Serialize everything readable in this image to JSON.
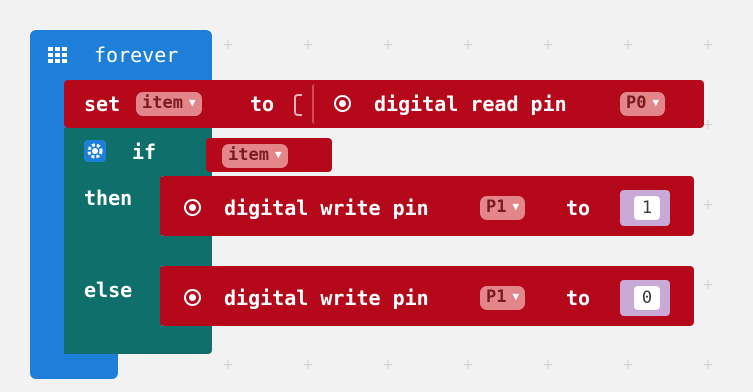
{
  "forever": {
    "label": "forever"
  },
  "set_block": {
    "set_label": "set",
    "variable": "item",
    "to_label": "to",
    "read_label": "digital read pin",
    "read_pin": "P0"
  },
  "if_block": {
    "if_label": "if",
    "condition_var": "item",
    "then_label": "then",
    "else_label": "else"
  },
  "write_then": {
    "label": "digital write pin",
    "pin": "P1",
    "to_label": "to",
    "value": "1"
  },
  "write_else": {
    "label": "digital write pin",
    "pin": "P1",
    "to_label": "to",
    "value": "0"
  },
  "colors": {
    "basic_blue": "#1e7fd8",
    "pins_red": "#b5081a",
    "logic_teal": "#0f6f6a",
    "dropdown": "#e2868a",
    "number_slot": "#c9a9d5"
  },
  "icons": {
    "forever": "grid-icon",
    "if_settings": "gear-icon",
    "pin": "radio-target-icon",
    "dropdown": "caret-down-icon"
  }
}
